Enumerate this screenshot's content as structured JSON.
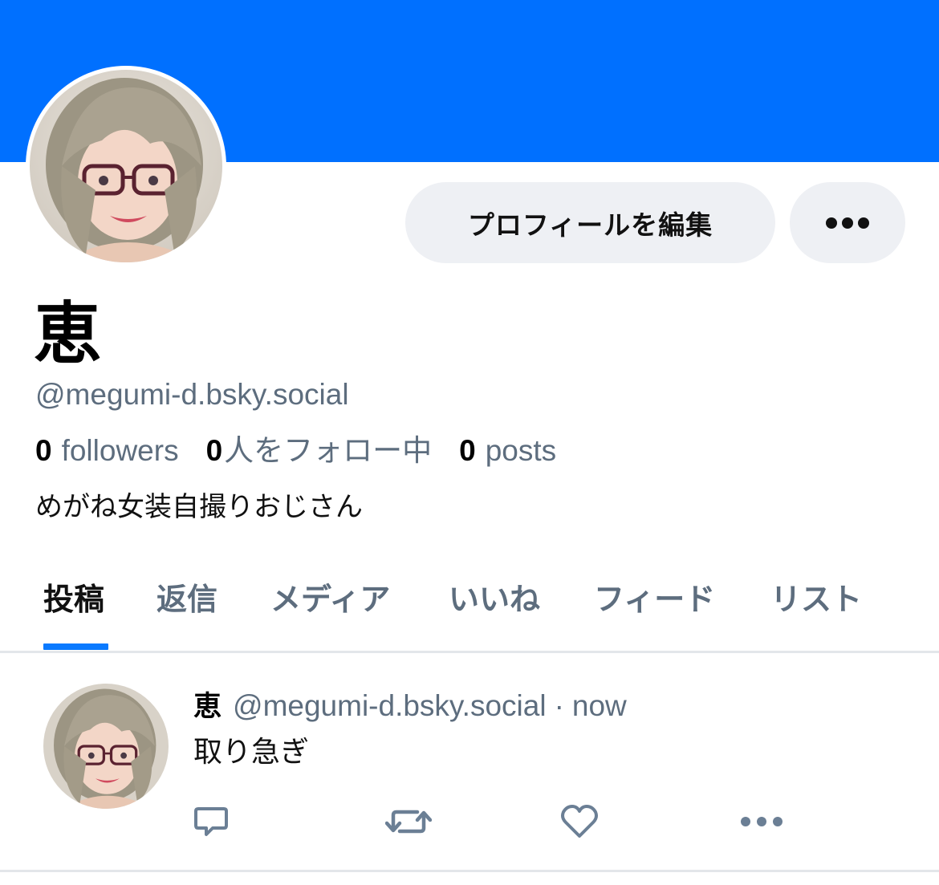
{
  "profile": {
    "display_name": "恵",
    "handle": "@megumi-d.bsky.social",
    "bio": "めがね女装自撮りおじさん",
    "edit_button_label": "プロフィールを編集",
    "banner_color": "#0070ff",
    "stats": {
      "followers_count": "0",
      "followers_label": "followers",
      "following_count": "0",
      "following_label": "人をフォロー中",
      "posts_count": "0",
      "posts_label": "posts"
    }
  },
  "tabs": [
    {
      "label": "投稿",
      "active": true
    },
    {
      "label": "返信",
      "active": false
    },
    {
      "label": "メディア",
      "active": false
    },
    {
      "label": "いいね",
      "active": false
    },
    {
      "label": "フィード",
      "active": false
    },
    {
      "label": "リスト",
      "active": false
    }
  ],
  "post": {
    "author": "恵",
    "handle": "@megumi-d.bsky.social",
    "separator": "·",
    "time": "now",
    "text": "取り急ぎ",
    "actions": [
      "reply-icon",
      "repost-icon",
      "like-icon",
      "more-icon"
    ]
  },
  "colors": {
    "accent": "#0a7aff",
    "muted_text": "#5d6d7e",
    "button_bg": "#eef0f4",
    "icon": "#6b7f95"
  }
}
